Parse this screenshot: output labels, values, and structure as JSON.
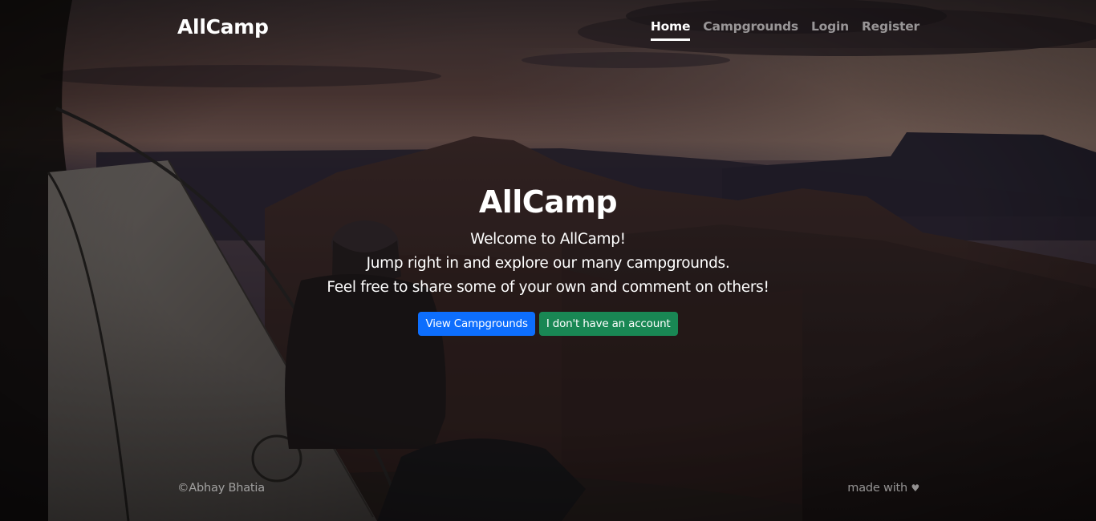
{
  "header": {
    "brand": "AllCamp",
    "nav": [
      {
        "label": "Home",
        "active": true
      },
      {
        "label": "Campgrounds",
        "active": false
      },
      {
        "label": "Login",
        "active": false
      },
      {
        "label": "Register",
        "active": false
      }
    ]
  },
  "hero": {
    "title": "AllCamp",
    "lines": [
      "Welcome to AllCamp!",
      "Jump right in and explore our many campgrounds.",
      "Feel free to share some of your own and comment on others!"
    ],
    "buttons": {
      "view_campgrounds": "View Campgrounds",
      "no_account": "I don't have an account"
    }
  },
  "footer": {
    "copyright": "©Abhay Bhatia",
    "made_with": "made with",
    "heart_icon": "♥"
  },
  "colors": {
    "primary": "#0d6efd",
    "success": "#198754"
  }
}
